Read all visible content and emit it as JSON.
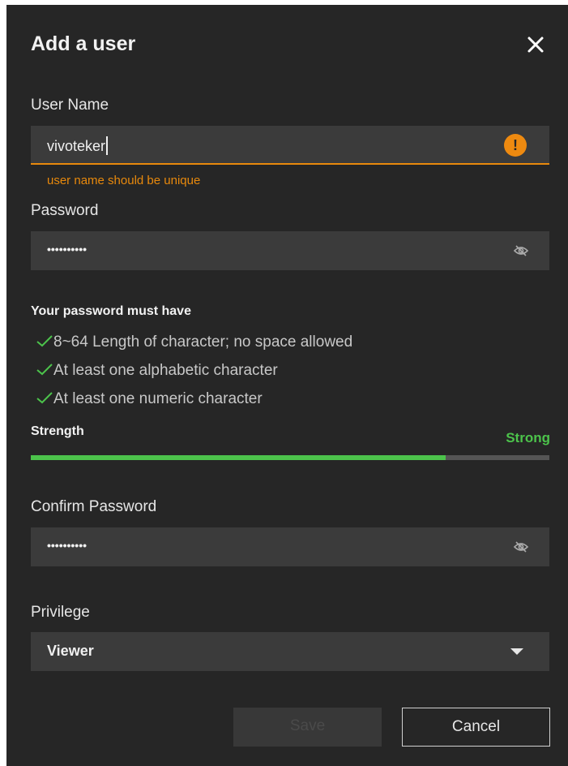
{
  "dialog": {
    "title": "Add a user",
    "close_icon": "close-icon"
  },
  "username": {
    "label": "User Name",
    "value": "vivoteker",
    "warning_icon": "warning-icon",
    "error": "user name should be unique"
  },
  "password": {
    "label": "Password",
    "masked_value": "••••••••••",
    "toggle_icon": "eye-hidden-icon"
  },
  "rules": {
    "title": "Your password must have",
    "check_icon": "check-icon",
    "items": [
      "8~64 Length of character; no space allowed",
      "At least one alphabetic character",
      "At least one numeric character"
    ]
  },
  "strength": {
    "label": "Strength",
    "value": "Strong",
    "level": 0.8
  },
  "confirm_password": {
    "label": "Confirm Password",
    "masked_value": "••••••••••",
    "toggle_icon": "eye-hidden-icon"
  },
  "privilege": {
    "label": "Privilege",
    "selected": "Viewer",
    "arrow_icon": "dropdown-arrow-icon"
  },
  "buttons": {
    "save": "Save",
    "cancel": "Cancel"
  },
  "colors": {
    "background": "#262626",
    "field": "#3b3b3b",
    "warning": "#e8890c",
    "success": "#4cc34b"
  }
}
